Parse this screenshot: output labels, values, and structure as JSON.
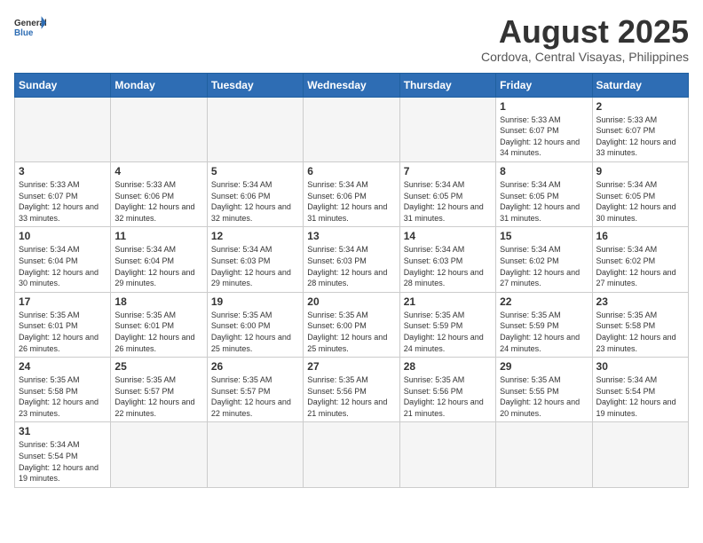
{
  "header": {
    "logo_general": "General",
    "logo_blue": "Blue",
    "month_year": "August 2025",
    "location": "Cordova, Central Visayas, Philippines"
  },
  "weekdays": [
    "Sunday",
    "Monday",
    "Tuesday",
    "Wednesday",
    "Thursday",
    "Friday",
    "Saturday"
  ],
  "weeks": [
    [
      {
        "day": "",
        "info": ""
      },
      {
        "day": "",
        "info": ""
      },
      {
        "day": "",
        "info": ""
      },
      {
        "day": "",
        "info": ""
      },
      {
        "day": "",
        "info": ""
      },
      {
        "day": "1",
        "info": "Sunrise: 5:33 AM\nSunset: 6:07 PM\nDaylight: 12 hours and 34 minutes."
      },
      {
        "day": "2",
        "info": "Sunrise: 5:33 AM\nSunset: 6:07 PM\nDaylight: 12 hours and 33 minutes."
      }
    ],
    [
      {
        "day": "3",
        "info": "Sunrise: 5:33 AM\nSunset: 6:07 PM\nDaylight: 12 hours and 33 minutes."
      },
      {
        "day": "4",
        "info": "Sunrise: 5:33 AM\nSunset: 6:06 PM\nDaylight: 12 hours and 32 minutes."
      },
      {
        "day": "5",
        "info": "Sunrise: 5:34 AM\nSunset: 6:06 PM\nDaylight: 12 hours and 32 minutes."
      },
      {
        "day": "6",
        "info": "Sunrise: 5:34 AM\nSunset: 6:06 PM\nDaylight: 12 hours and 31 minutes."
      },
      {
        "day": "7",
        "info": "Sunrise: 5:34 AM\nSunset: 6:05 PM\nDaylight: 12 hours and 31 minutes."
      },
      {
        "day": "8",
        "info": "Sunrise: 5:34 AM\nSunset: 6:05 PM\nDaylight: 12 hours and 31 minutes."
      },
      {
        "day": "9",
        "info": "Sunrise: 5:34 AM\nSunset: 6:05 PM\nDaylight: 12 hours and 30 minutes."
      }
    ],
    [
      {
        "day": "10",
        "info": "Sunrise: 5:34 AM\nSunset: 6:04 PM\nDaylight: 12 hours and 30 minutes."
      },
      {
        "day": "11",
        "info": "Sunrise: 5:34 AM\nSunset: 6:04 PM\nDaylight: 12 hours and 29 minutes."
      },
      {
        "day": "12",
        "info": "Sunrise: 5:34 AM\nSunset: 6:03 PM\nDaylight: 12 hours and 29 minutes."
      },
      {
        "day": "13",
        "info": "Sunrise: 5:34 AM\nSunset: 6:03 PM\nDaylight: 12 hours and 28 minutes."
      },
      {
        "day": "14",
        "info": "Sunrise: 5:34 AM\nSunset: 6:03 PM\nDaylight: 12 hours and 28 minutes."
      },
      {
        "day": "15",
        "info": "Sunrise: 5:34 AM\nSunset: 6:02 PM\nDaylight: 12 hours and 27 minutes."
      },
      {
        "day": "16",
        "info": "Sunrise: 5:34 AM\nSunset: 6:02 PM\nDaylight: 12 hours and 27 minutes."
      }
    ],
    [
      {
        "day": "17",
        "info": "Sunrise: 5:35 AM\nSunset: 6:01 PM\nDaylight: 12 hours and 26 minutes."
      },
      {
        "day": "18",
        "info": "Sunrise: 5:35 AM\nSunset: 6:01 PM\nDaylight: 12 hours and 26 minutes."
      },
      {
        "day": "19",
        "info": "Sunrise: 5:35 AM\nSunset: 6:00 PM\nDaylight: 12 hours and 25 minutes."
      },
      {
        "day": "20",
        "info": "Sunrise: 5:35 AM\nSunset: 6:00 PM\nDaylight: 12 hours and 25 minutes."
      },
      {
        "day": "21",
        "info": "Sunrise: 5:35 AM\nSunset: 5:59 PM\nDaylight: 12 hours and 24 minutes."
      },
      {
        "day": "22",
        "info": "Sunrise: 5:35 AM\nSunset: 5:59 PM\nDaylight: 12 hours and 24 minutes."
      },
      {
        "day": "23",
        "info": "Sunrise: 5:35 AM\nSunset: 5:58 PM\nDaylight: 12 hours and 23 minutes."
      }
    ],
    [
      {
        "day": "24",
        "info": "Sunrise: 5:35 AM\nSunset: 5:58 PM\nDaylight: 12 hours and 23 minutes."
      },
      {
        "day": "25",
        "info": "Sunrise: 5:35 AM\nSunset: 5:57 PM\nDaylight: 12 hours and 22 minutes."
      },
      {
        "day": "26",
        "info": "Sunrise: 5:35 AM\nSunset: 5:57 PM\nDaylight: 12 hours and 22 minutes."
      },
      {
        "day": "27",
        "info": "Sunrise: 5:35 AM\nSunset: 5:56 PM\nDaylight: 12 hours and 21 minutes."
      },
      {
        "day": "28",
        "info": "Sunrise: 5:35 AM\nSunset: 5:56 PM\nDaylight: 12 hours and 21 minutes."
      },
      {
        "day": "29",
        "info": "Sunrise: 5:35 AM\nSunset: 5:55 PM\nDaylight: 12 hours and 20 minutes."
      },
      {
        "day": "30",
        "info": "Sunrise: 5:34 AM\nSunset: 5:54 PM\nDaylight: 12 hours and 19 minutes."
      }
    ],
    [
      {
        "day": "31",
        "info": "Sunrise: 5:34 AM\nSunset: 5:54 PM\nDaylight: 12 hours and 19 minutes."
      },
      {
        "day": "",
        "info": ""
      },
      {
        "day": "",
        "info": ""
      },
      {
        "day": "",
        "info": ""
      },
      {
        "day": "",
        "info": ""
      },
      {
        "day": "",
        "info": ""
      },
      {
        "day": "",
        "info": ""
      }
    ]
  ]
}
